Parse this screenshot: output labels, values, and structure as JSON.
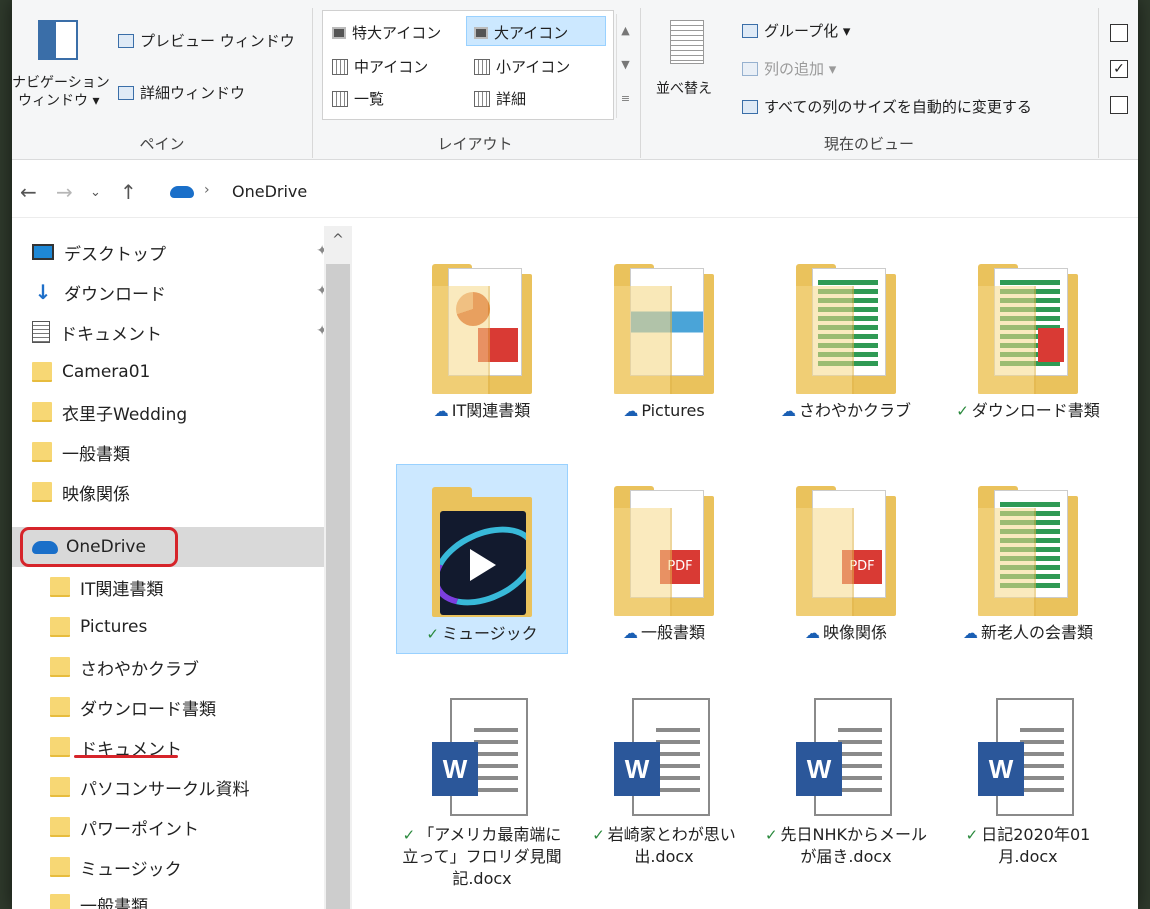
{
  "ribbon": {
    "pane": {
      "preview": "プレビュー ウィンドウ",
      "details": "詳細ウィンドウ",
      "nav1": "ナビゲーション",
      "nav2": "ウィンドウ ▾",
      "group": "ペイン"
    },
    "layout": {
      "items": [
        "特大アイコン",
        "大アイコン",
        "中アイコン",
        "小アイコン",
        "一覧",
        "詳細"
      ],
      "group": "レイアウト"
    },
    "current_view": {
      "sort": "並べ替え",
      "group_by": "グループ化 ▾",
      "add_column": "列の追加 ▾",
      "autosize": "すべての列のサイズを自動的に変更する",
      "group": "現在のビュー"
    }
  },
  "address": {
    "path": "OneDrive"
  },
  "sidebar": {
    "quick": [
      "デスクトップ",
      "ダウンロード",
      "ドキュメント"
    ],
    "folders": [
      "Camera01",
      "衣里子Wedding",
      "一般書類",
      "映像関係"
    ],
    "onedrive": "OneDrive",
    "onedrive_children": [
      "IT関連書類",
      "Pictures",
      "さわやかクラブ",
      "ダウンロード書類",
      "ドキュメント",
      "パソコンサークル資料",
      "パワーポイント",
      "ミュージック",
      "一般書類"
    ]
  },
  "content": {
    "row1": [
      "IT関連書類",
      "Pictures",
      "さわやかクラブ",
      "ダウンロード書類"
    ],
    "row2": [
      "ミュージック",
      "一般書類",
      "映像関係",
      "新老人の会書類"
    ],
    "row3": [
      "「アメリカ最南端に立って」フロリダ見聞記.docx",
      "岩崎家とわが思い出.docx",
      "先日NHKからメールが届き.docx",
      "日記2020年01月.docx"
    ],
    "status_cloud": "☁",
    "status_ok": "✓"
  },
  "colors": {
    "accent": "#cce8ff",
    "highlight": "#d6242a",
    "word": "#2b579a"
  }
}
